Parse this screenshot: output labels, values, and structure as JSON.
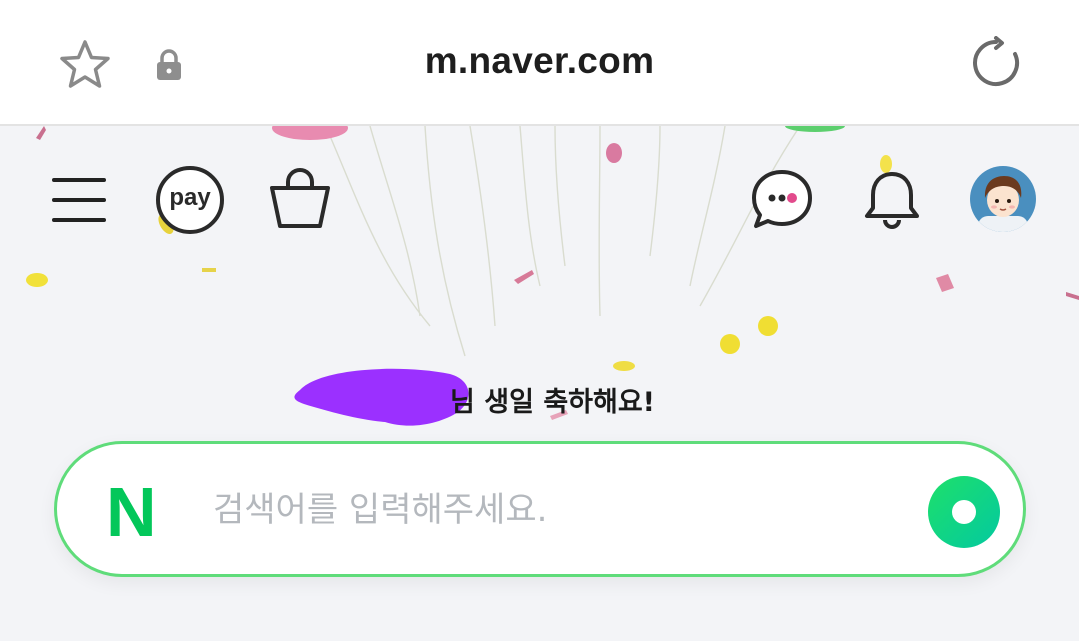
{
  "browser": {
    "url": "m.naver.com",
    "icons": [
      "star-outline-icon",
      "lock-icon",
      "reload-icon"
    ]
  },
  "header": {
    "icons": [
      "menu-icon",
      "pay-icon",
      "shopping-bag-icon",
      "chat-bubble-icon",
      "bell-icon",
      "avatar"
    ],
    "pay_label": "pay"
  },
  "greeting": {
    "text": "님 생일 축하해요!"
  },
  "search": {
    "logo_letter": "N",
    "placeholder": "검색어를 입력해주세요.",
    "value": ""
  },
  "colors": {
    "accent_green": "#03c75a",
    "search_border": "#5fdc7a",
    "redaction_purple": "#9b30ff"
  }
}
